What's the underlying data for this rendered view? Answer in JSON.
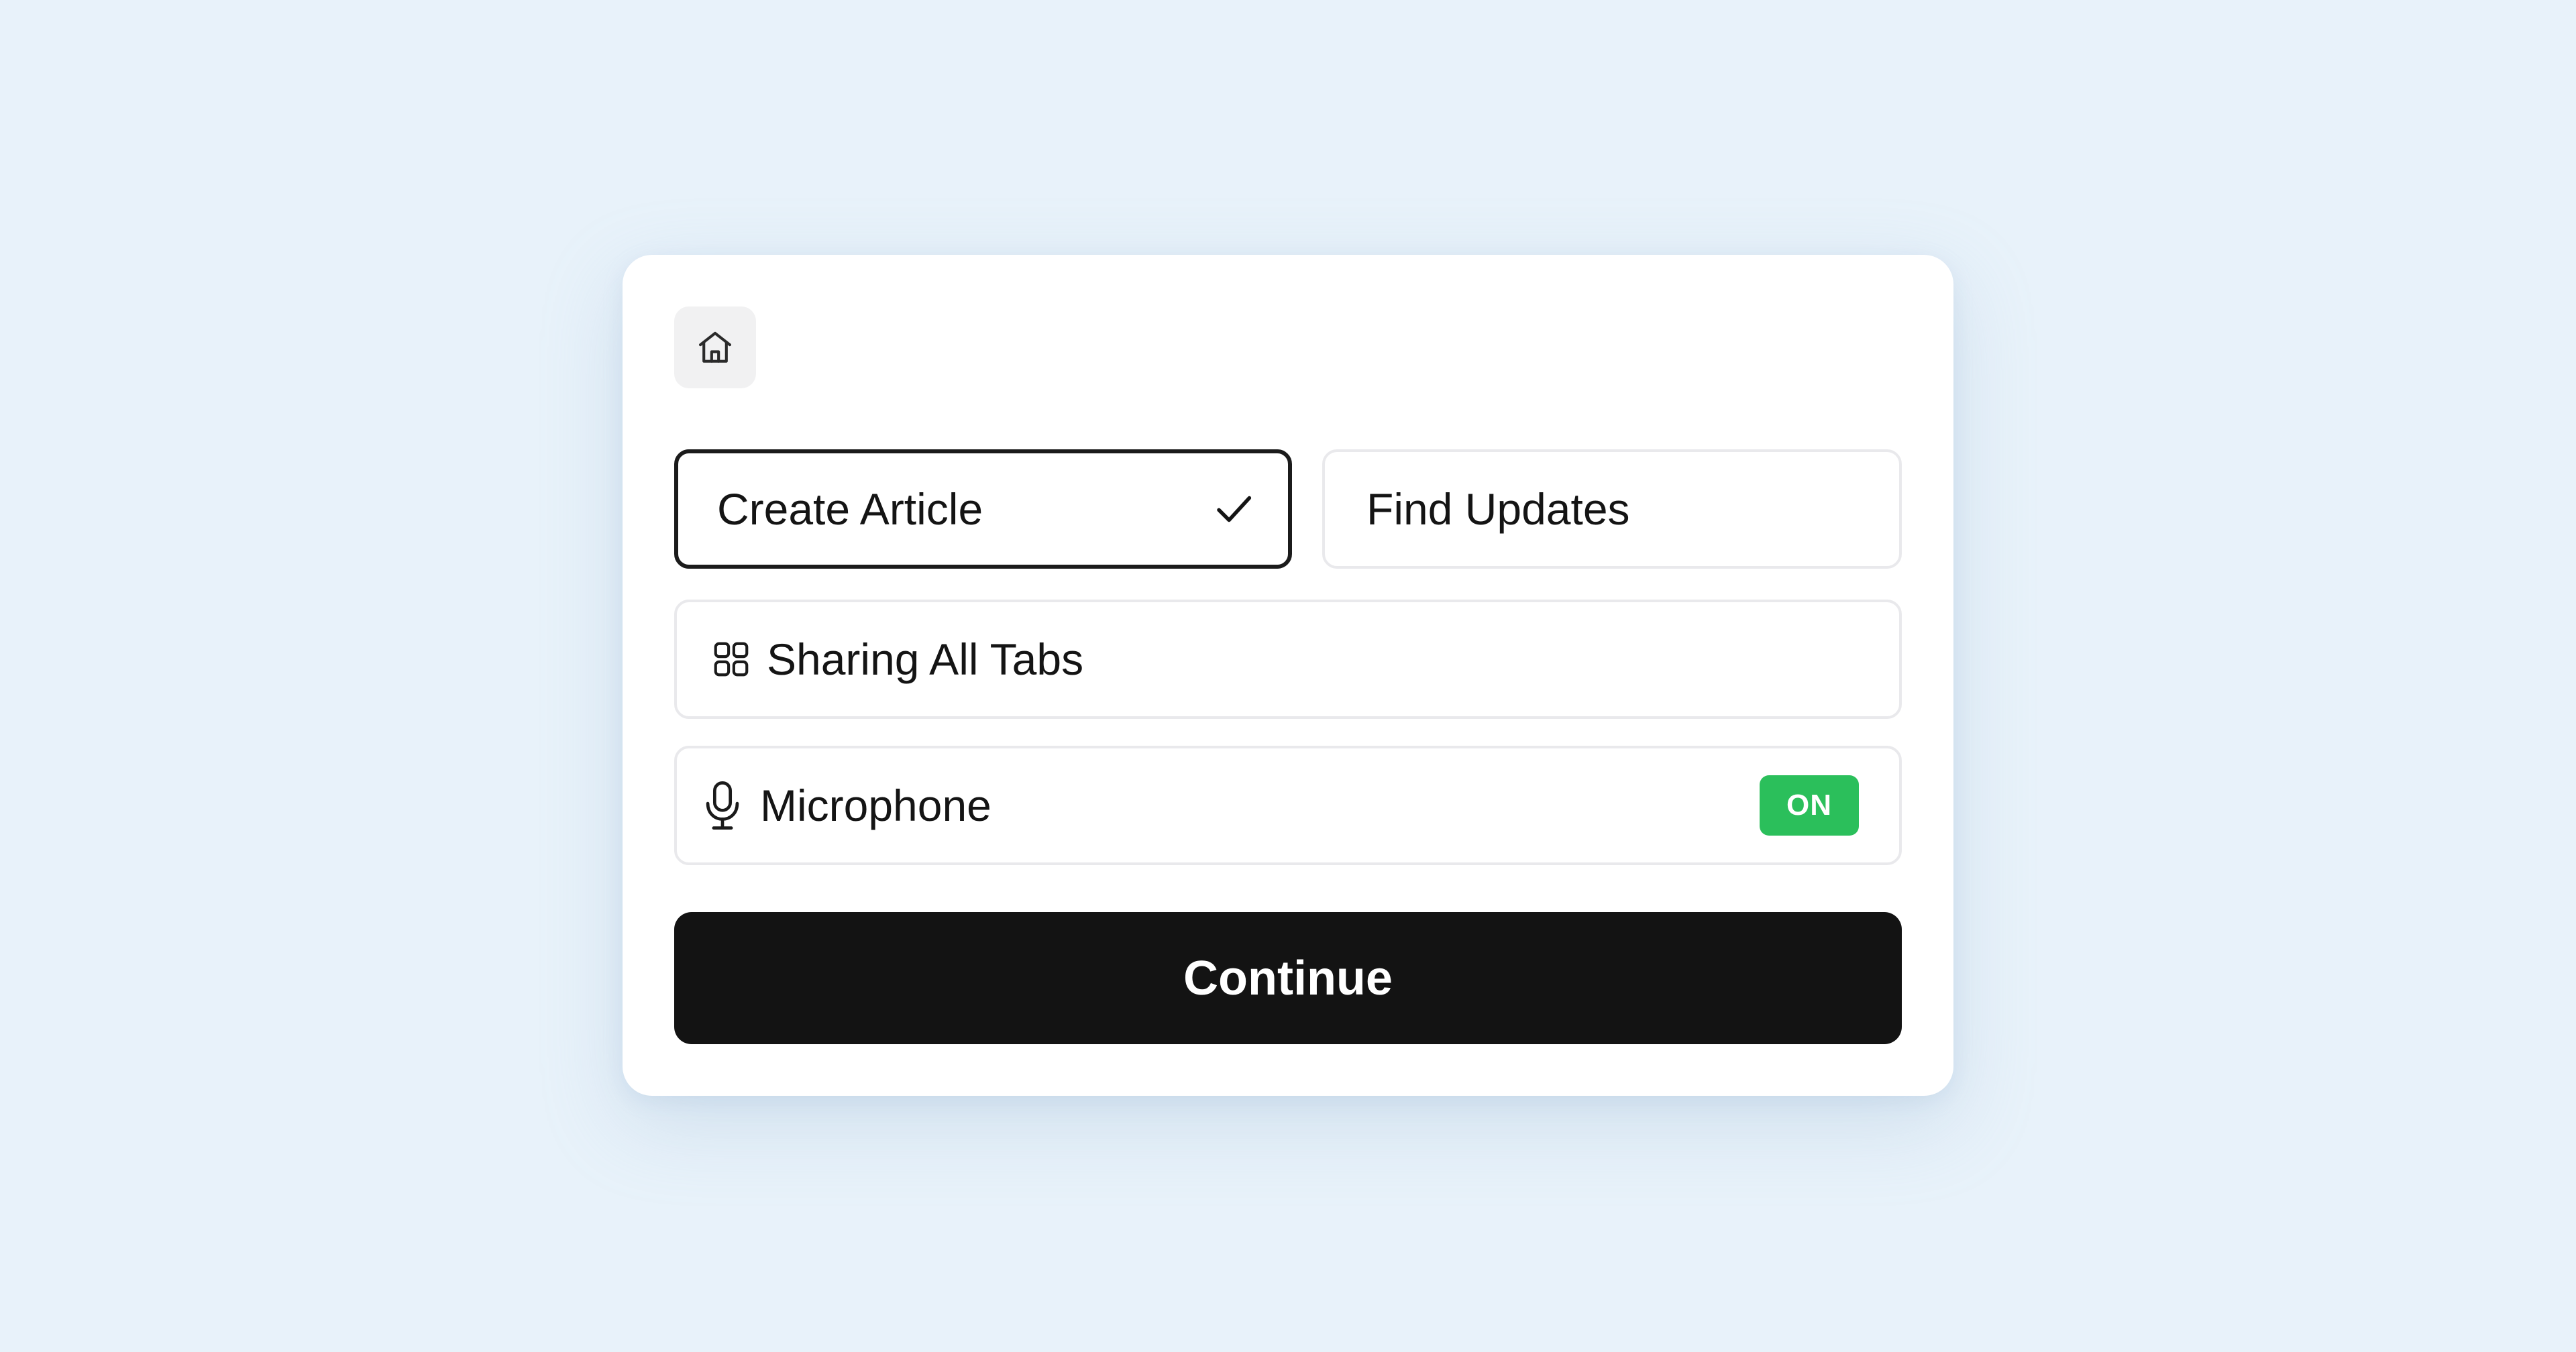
{
  "icons": {
    "home": "home-icon",
    "check": "check-icon",
    "grid": "grid-icon",
    "microphone": "microphone-icon"
  },
  "options": {
    "create_article": {
      "label": "Create Article",
      "selected": true
    },
    "find_updates": {
      "label": "Find Updates",
      "selected": false
    },
    "sharing": {
      "label": "Sharing All Tabs"
    },
    "microphone": {
      "label": "Microphone",
      "status": "ON"
    }
  },
  "continue_label": "Continue",
  "colors": {
    "background": "#e8f2fa",
    "card": "#ffffff",
    "selected_border": "#1b1b1b",
    "status_on": "#2bbf5b",
    "primary_button": "#131313"
  }
}
